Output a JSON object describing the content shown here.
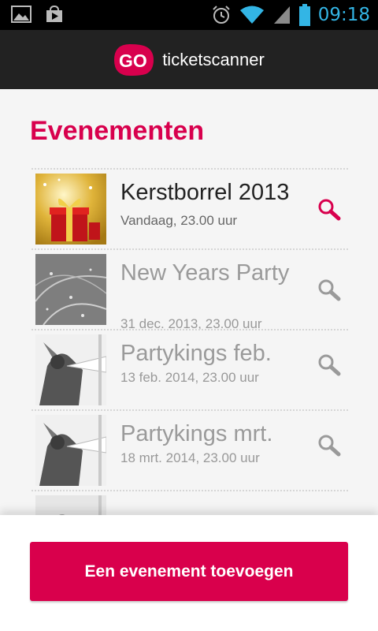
{
  "status_bar": {
    "time": "09:18",
    "icons": [
      "gallery-icon",
      "store-icon",
      "alarm-icon",
      "wifi-icon",
      "signal-icon",
      "battery-icon"
    ],
    "time_color": "#33b5e5"
  },
  "app_bar": {
    "logo_text": "GO",
    "brand_name": "ticketscanner"
  },
  "main": {
    "title": "Evenementen",
    "events": [
      {
        "title": "Kerstborrel 2013",
        "date": "Vandaag, 23.00 uur",
        "state": "active",
        "thumb": "christmas-gift"
      },
      {
        "title": "New Years Party",
        "date": "31 dec. 2013, 23.00 uur",
        "state": "inactive",
        "thumb": "sparkles"
      },
      {
        "title": "Partykings feb.",
        "date": "13 feb. 2014, 23.00 uur",
        "state": "inactive",
        "thumb": "party-crowd"
      },
      {
        "title": "Partykings mrt.",
        "date": "18 mrt. 2014, 23.00 uur",
        "state": "inactive",
        "thumb": "party-crowd"
      },
      {
        "title": "",
        "date": "",
        "state": "inactive",
        "thumb": "party-crowd"
      }
    ]
  },
  "footer": {
    "add_button_label": "Een evenement toevoegen"
  },
  "colors": {
    "accent": "#d8004d",
    "app_bar": "#222222",
    "background": "#f5f5f5"
  }
}
